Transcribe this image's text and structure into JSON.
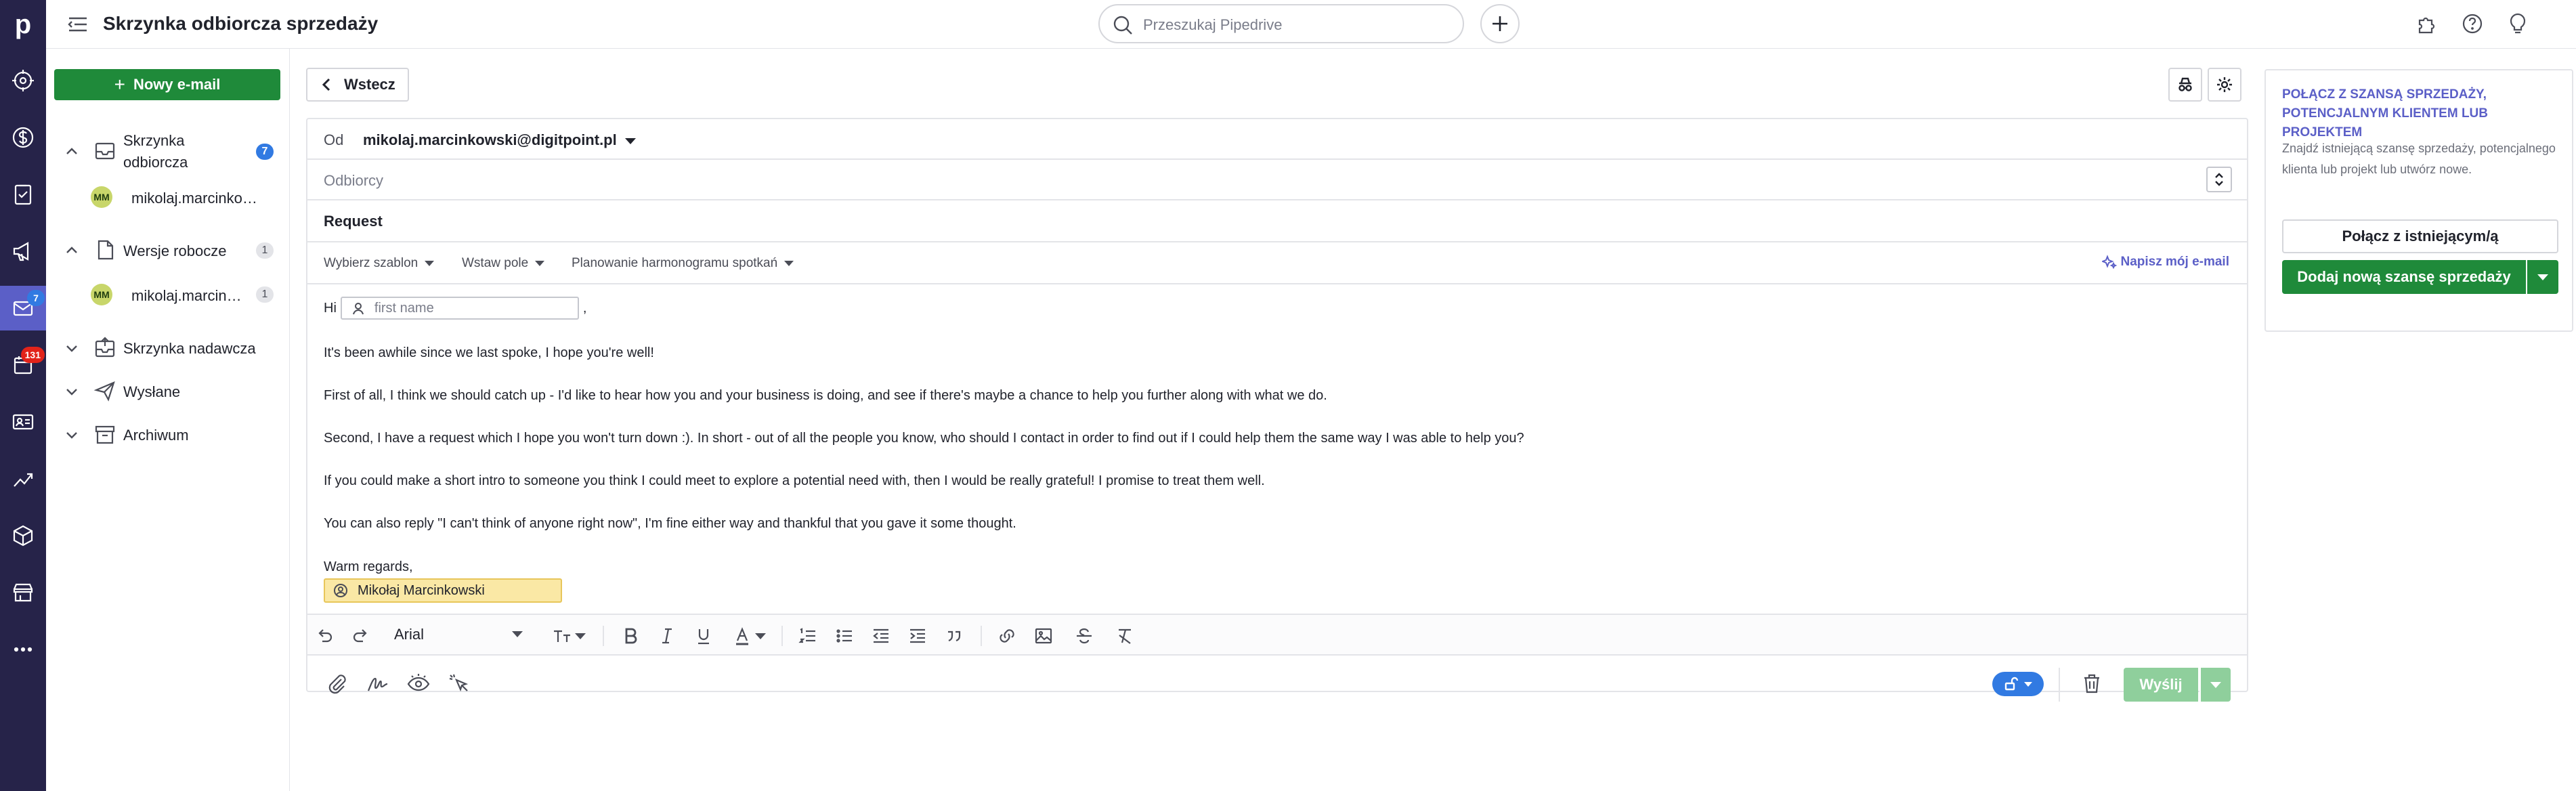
{
  "app": {
    "logo_letter": "p",
    "page_title": "Skrzynka odbiorcza sprzedaży",
    "search_placeholder": "Przeszukaj Pipedrive"
  },
  "rail": {
    "items": [
      {
        "icon": "target-icon"
      },
      {
        "icon": "dollar-icon"
      },
      {
        "icon": "tasks-icon"
      },
      {
        "icon": "megaphone-icon"
      },
      {
        "icon": "mail-icon",
        "badge": "7",
        "active": true
      },
      {
        "icon": "calendar-icon",
        "badge": "131"
      },
      {
        "icon": "contacts-icon"
      },
      {
        "icon": "insights-icon"
      },
      {
        "icon": "products-icon"
      },
      {
        "icon": "marketplace-icon"
      },
      {
        "icon": "more-icon"
      }
    ]
  },
  "sidebar": {
    "new_email_label": "Nowy e-mail",
    "inbox": {
      "label_line1": "Skrzynka",
      "label_line2": "odbiorcza",
      "count": "7"
    },
    "inbox_account": {
      "initials": "MM",
      "label": "mikolaj.marcinkowski@digitpoint.pl"
    },
    "drafts": {
      "label": "Wersje robocze",
      "count": "1"
    },
    "drafts_account": {
      "initials": "MM",
      "label": "mikolaj.marcinkowski@digitpoint.pl",
      "count": "1"
    },
    "outbox": {
      "label": "Skrzynka nadawcza"
    },
    "sent": {
      "label": "Wysłane"
    },
    "archive": {
      "label": "Archiwum"
    }
  },
  "compose": {
    "back_label": "Wstecz",
    "from_label": "Od",
    "from_value": "mikolaj.marcinkowski@digitpoint.pl",
    "recipients_placeholder": "Odbiorcy",
    "subject": "Request",
    "toolbar": {
      "template": "Wybierz szablon",
      "insert_field": "Wstaw pole",
      "scheduling": "Planowanie harmonogramu spotkań",
      "ai_write": "Napisz mój e-mail"
    },
    "body": {
      "greeting": "Hi",
      "merge_placeholder": "first name",
      "greeting_punct": ",",
      "p1": "It's been awhile since we last spoke, I hope you're well!",
      "p2": "First of all, I think we should catch up - I'd like to hear how you and your business is doing, and see if there's maybe a chance to help you further along with what we do.",
      "p3": "Second, I have a request which I hope you won't turn down :). In short - out of all the people you know, who should I contact in order to find out if I could help them the same way I was able to help you?",
      "p4": "If you could make a short intro to someone you think I could meet to explore a potential need with, then I would be really grateful! I promise to treat them well.",
      "p5": "You can also reply \"I can't think of anyone right now\", I'm fine either way and thankful that you gave it some thought.",
      "closing": "Warm regards,",
      "signature": "Mikołaj Marcinkowski"
    },
    "font_name": "Arial",
    "send_label": "Wyślij"
  },
  "right_panel": {
    "title": "Połącz z szansą sprzedaży, potencjalnym klientem lub projektem",
    "description": "Znajdź istniejącą szansę sprzedaży, potencjalnego klienta lub projekt lub utwórz nowe.",
    "link_existing": "Połącz z istniejącym/ą",
    "add_deal": "Dodaj nową szansę sprzedaży"
  },
  "colors": {
    "rail_bg": "#262349",
    "accent": "#5b5fc7",
    "primary_green": "#1f8a3a",
    "disabled_green": "#8fcf9c",
    "badge_blue": "#317ae2",
    "badge_red": "#e2231a"
  }
}
